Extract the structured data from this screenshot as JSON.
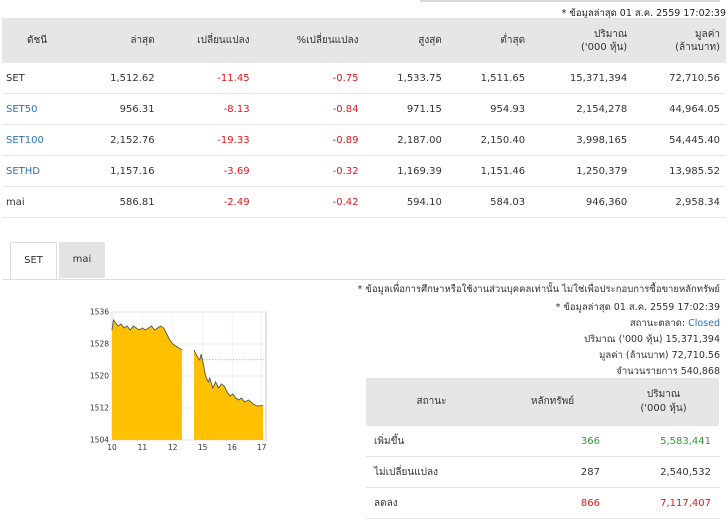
{
  "top_note": "* ข้อมูลล่าสุด 01 ส.ค. 2559 17:02:39",
  "index_table": {
    "headers": [
      "ดัชนี",
      "ล่าสุด",
      "เปลี่ยนแปลง",
      "%เปลี่ยนแปลง",
      "สูงสุด",
      "ต่ำสุด",
      "ปริมาณ\n('000 หุ้น)",
      "มูลค่า\n(ล้านบาท)"
    ],
    "header_lines": {
      "volume": [
        "ปริมาณ",
        "('000 หุ้น)"
      ],
      "value": [
        "มูลค่า",
        "(ล้านบาท)"
      ]
    },
    "rows": [
      {
        "name": "SET",
        "last": "1,512.62",
        "change": "-11.45",
        "pct": "-0.75",
        "high": "1,533.75",
        "low": "1,511.65",
        "volume": "15,371,394",
        "value": "72,710.56"
      },
      {
        "name": "SET50",
        "last": "956.31",
        "change": "-8.13",
        "pct": "-0.84",
        "high": "971.15",
        "low": "954.93",
        "volume": "2,154,278",
        "value": "44,964.05"
      },
      {
        "name": "SET100",
        "last": "2,152.76",
        "change": "-19.33",
        "pct": "-0.89",
        "high": "2,187.00",
        "low": "2,150.40",
        "volume": "3,998,165",
        "value": "54,445.40"
      },
      {
        "name": "SETHD",
        "last": "1,157.16",
        "change": "-3.69",
        "pct": "-0.32",
        "high": "1,169.39",
        "low": "1,151.46",
        "volume": "1,250,379",
        "value": "13,985.52"
      },
      {
        "name": "mai",
        "last": "586.81",
        "change": "-2.49",
        "pct": "-0.42",
        "high": "594.10",
        "low": "584.03",
        "volume": "946,360",
        "value": "2,958.34"
      }
    ]
  },
  "tabs": [
    "SET",
    "mai"
  ],
  "disclaimer": "* ข้อมูลเพื่อการศึกษาหรือใช้งานส่วนบุคคลเท่านั้น ไม่ใช่เพื่อประกอบการซื้อขายหลักทรัพย์",
  "info": {
    "updated": "* ข้อมูลล่าสุด 01 ส.ค. 2559 17:02:39",
    "market_status_label": "สถานะตลาด:",
    "market_status_value": "Closed",
    "volume_label": "ปริมาณ ('000 หุ้น)",
    "volume_value": "15,371,394",
    "value_label": "มูลค่า (ล้านบาท)",
    "value_value": "72,710.56",
    "trades_label": "จำนวนรายการ",
    "trades_value": "540,868"
  },
  "stat_table": {
    "headers": [
      "สถานะ",
      "หลักทรัพย์",
      "ปริมาณ"
    ],
    "header_sub": "('000 หุ้น)",
    "rows": [
      {
        "status": "เพิ่มขึ้น",
        "count": "366",
        "volume": "5,583,441",
        "color": "green"
      },
      {
        "status": "ไม่เปลี่ยนแปลง",
        "count": "287",
        "volume": "2,540,532",
        "color": "none"
      },
      {
        "status": "ลดลง",
        "count": "866",
        "volume": "7,117,407",
        "color": "red"
      }
    ]
  },
  "chart_data": {
    "type": "area",
    "y_ticks": [
      "1536",
      "1528",
      "1520",
      "1512",
      "1504"
    ],
    "x_ticks": [
      "10",
      "11",
      "12",
      "15",
      "16",
      "17"
    ],
    "ylim": [
      1504,
      1536
    ],
    "reference_line": 1524.07,
    "colors": {
      "fill": "#ffc000",
      "line": "#555555",
      "reference": "#ffa200"
    },
    "morning": [
      [
        10.0,
        1531.5
      ],
      [
        10.05,
        1534.0
      ],
      [
        10.1,
        1533.5
      ],
      [
        10.2,
        1532.5
      ],
      [
        10.3,
        1533.0
      ],
      [
        10.4,
        1532.0
      ],
      [
        10.5,
        1532.5
      ],
      [
        10.6,
        1531.5
      ],
      [
        10.7,
        1532.5
      ],
      [
        10.8,
        1532.0
      ],
      [
        10.9,
        1531.5
      ],
      [
        11.0,
        1532.0
      ],
      [
        11.1,
        1531.5
      ],
      [
        11.2,
        1532.0
      ],
      [
        11.3,
        1532.5
      ],
      [
        11.4,
        1531.5
      ],
      [
        11.5,
        1532.0
      ],
      [
        11.6,
        1532.5
      ],
      [
        11.7,
        1532.0
      ],
      [
        11.8,
        1530.5
      ],
      [
        11.9,
        1529.0
      ],
      [
        12.0,
        1528.0
      ],
      [
        12.1,
        1527.5
      ],
      [
        12.2,
        1527.0
      ],
      [
        12.3,
        1526.5
      ]
    ],
    "afternoon": [
      [
        14.5,
        1526.5
      ],
      [
        14.6,
        1525.0
      ],
      [
        14.7,
        1524.0
      ],
      [
        14.75,
        1525.5
      ],
      [
        14.85,
        1522.0
      ],
      [
        14.9,
        1520.0
      ],
      [
        15.0,
        1518.5
      ],
      [
        15.05,
        1519.5
      ],
      [
        15.15,
        1517.0
      ],
      [
        15.25,
        1518.5
      ],
      [
        15.35,
        1517.0
      ],
      [
        15.45,
        1518.0
      ],
      [
        15.55,
        1517.5
      ],
      [
        15.65,
        1516.0
      ],
      [
        15.75,
        1515.0
      ],
      [
        15.85,
        1515.5
      ],
      [
        15.95,
        1514.5
      ],
      [
        16.05,
        1514.0
      ],
      [
        16.15,
        1514.5
      ],
      [
        16.25,
        1513.5
      ],
      [
        16.4,
        1514.0
      ],
      [
        16.55,
        1513.0
      ],
      [
        16.7,
        1512.5
      ],
      [
        16.9,
        1512.6
      ]
    ]
  }
}
